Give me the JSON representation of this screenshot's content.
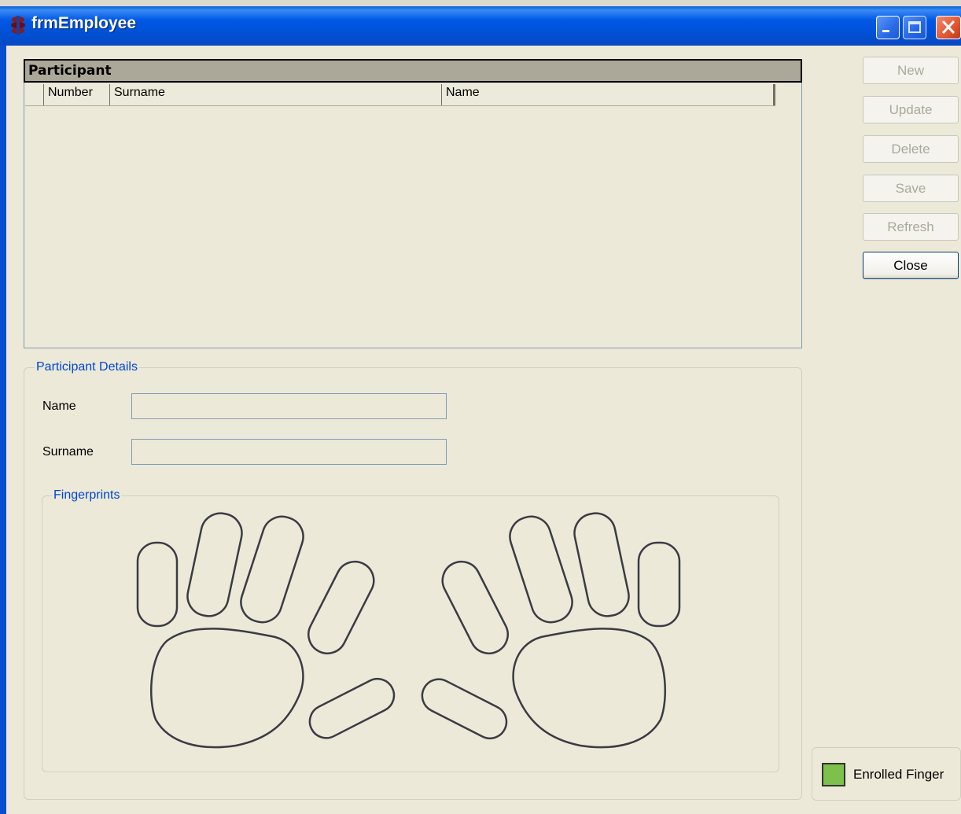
{
  "window": {
    "title": "frmEmployee"
  },
  "participant_grid": {
    "title": "Participant",
    "columns": [
      "Number",
      "Surname",
      "Name"
    ],
    "rows": []
  },
  "buttons": {
    "new_label": "New",
    "update_label": "Update",
    "delete_label": "Delete",
    "save_label": "Save",
    "refresh_label": "Refresh",
    "close_label": "Close"
  },
  "details": {
    "group_title": "Participant Details",
    "name_label": "Name",
    "name_value": "",
    "surname_label": "Surname",
    "surname_value": ""
  },
  "fingerprints": {
    "group_title": "Fingerprints"
  },
  "legend": {
    "label": "Enrolled Finger",
    "color": "#7dc04b"
  }
}
